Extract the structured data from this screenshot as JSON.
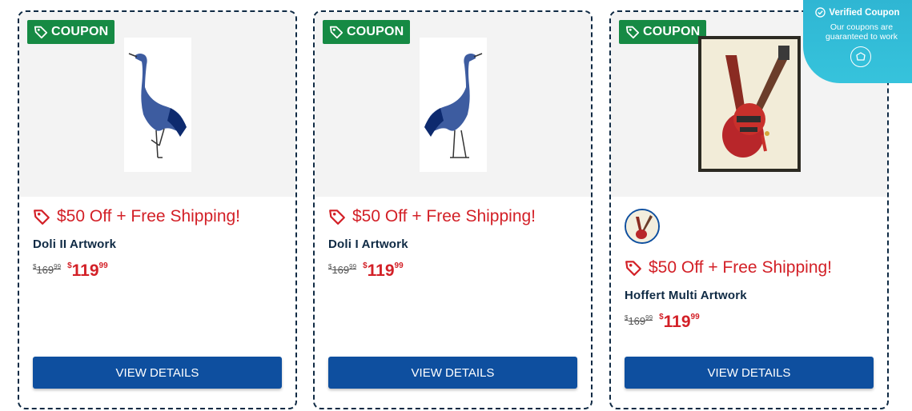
{
  "badge_label": "COUPON",
  "colors": {
    "coupon_green": "#168a44",
    "offer_red": "#d32027",
    "button_blue": "#0e4f9f",
    "banner_cyan": "#2fb6d3",
    "dashed_border": "#0f2a44"
  },
  "cards": [
    {
      "offer": "$50 Off + Free Shipping!",
      "name": "Doli II Artwork",
      "old_price": {
        "symbol": "$",
        "whole": "169",
        "cents": "99"
      },
      "new_price": {
        "symbol": "$",
        "whole": "119",
        "cents": "99"
      },
      "button_label": "VIEW DETAILS",
      "image_icon": "crane-artwork-image"
    },
    {
      "offer": "$50 Off + Free Shipping!",
      "name": "Doli I Artwork",
      "old_price": {
        "symbol": "$",
        "whole": "169",
        "cents": "99"
      },
      "new_price": {
        "symbol": "$",
        "whole": "119",
        "cents": "99"
      },
      "button_label": "VIEW DETAILS",
      "image_icon": "crane-artwork-image"
    },
    {
      "offer": "$50 Off + Free Shipping!",
      "name": "Hoffert Multi Artwork",
      "old_price": {
        "symbol": "$",
        "whole": "169",
        "cents": "99"
      },
      "new_price": {
        "symbol": "$",
        "whole": "119",
        "cents": "99"
      },
      "button_label": "VIEW DETAILS",
      "image_icon": "guitar-artwork-image"
    }
  ],
  "verified": {
    "title": "Verified Coupon",
    "line1": "Our coupons are",
    "line2": "guaranteed to work"
  }
}
